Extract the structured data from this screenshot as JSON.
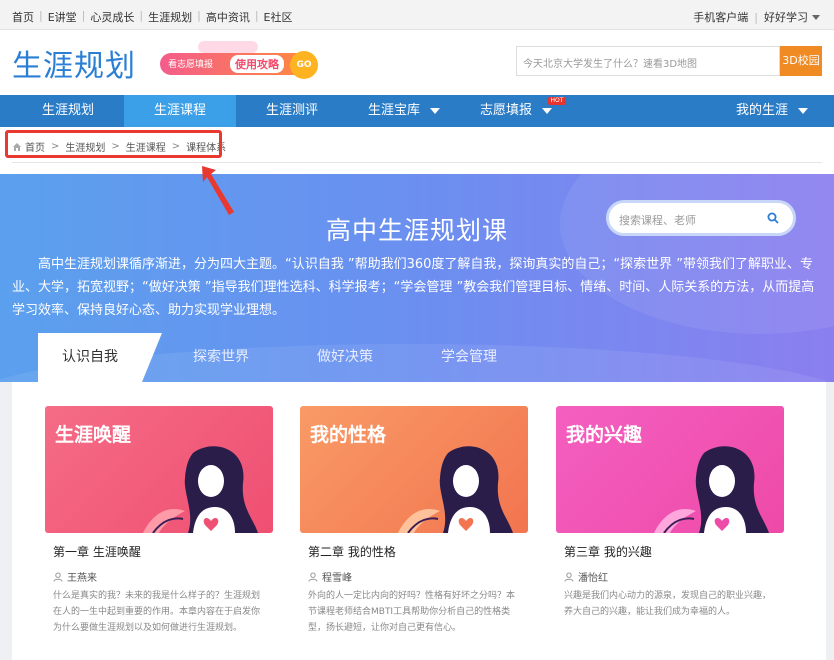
{
  "topbar": {
    "links": [
      "首页",
      "E讲堂",
      "心灵成长",
      "生涯规划",
      "高中资讯",
      "E社区"
    ],
    "mobile": "手机客户端",
    "user": "好好学习"
  },
  "header": {
    "logo": "生涯规划",
    "promo_left": "看志愿填报",
    "promo_right": "使用攻略",
    "promo_go": "GO",
    "search_placeholder": "今天北京大学发生了什么？速看3D地图",
    "search_button": "3D校园"
  },
  "nav": {
    "items": [
      "生涯规划",
      "生涯课程",
      "生涯测评",
      "生涯宝库",
      "志愿填报"
    ],
    "hot_badge": "HOT",
    "right": "我的生涯"
  },
  "breadcrumb": [
    "首页",
    "生涯规划",
    "生涯课程",
    "课程体系"
  ],
  "banner": {
    "title": "高中生涯规划课",
    "desc": "高中生涯规划课循序渐进，分为四大主题。“认识自我 ”帮助我们360度了解自我，探询真实的自己；“探索世界 ”带领我们了解职业、专业、大学，拓宽视野；“做好决策 ”指导我们理性选科、科学报考；“学会管理 ”教会我们管理目标、情绪、时间、人际关系的方法，从而提高学习效率、保持良好心态、助力实现学业理想。",
    "search_placeholder": "搜索课程、老师",
    "tabs": [
      "认识自我",
      "探索世界",
      "做好决策",
      "学会管理"
    ]
  },
  "cards": [
    {
      "image_title": "生涯唤醒",
      "chapter": "第一章 生涯唤醒",
      "author": "王燕来",
      "desc": "什么是真实的我？未来的我是什么样子的？生涯规划在人的一生中起到重要的作用。本章内容在于启发你为什么要做生涯规划以及如何做进行生涯规划。",
      "color": "#f26b84"
    },
    {
      "image_title": "我的性格",
      "chapter": "第二章 我的性格",
      "author": "程雪峰",
      "desc": "外向的人一定比内向的好吗？性格有好坏之分吗？本节课程老师结合MBTI工具帮助你分析自己的性格类型，扬长避短，让你对自己更有信心。",
      "color": "#f7895f"
    },
    {
      "image_title": "我的兴趣",
      "chapter": "第三章 我的兴趣",
      "author": "潘怡红",
      "desc": "兴趣是我们内心动力的源泉，发现自己的职业兴趣，养大自己的兴趣，能让我们成为幸福的人。",
      "color": "#f05ab3"
    }
  ],
  "colors": {
    "nav_bg": "#2a7cc7",
    "nav_active": "#3ba0e8",
    "logo": "#2a7fd4",
    "highlight_box": "#e8382f"
  }
}
